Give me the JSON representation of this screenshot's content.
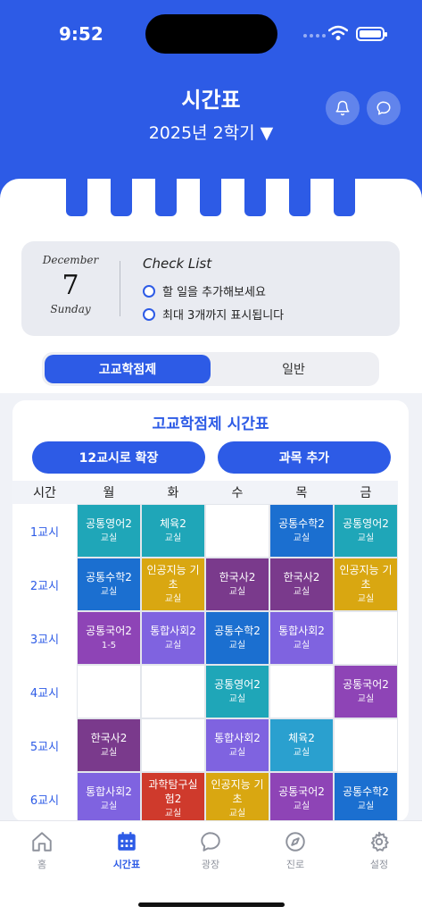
{
  "status_bar": {
    "time": "9:52"
  },
  "header": {
    "title": "시간표",
    "semester": "2025년 2학기 ▼",
    "bell_icon": "bell-icon",
    "chat_icon": "chat-bubble-icon"
  },
  "checklist": {
    "month": "December",
    "day": "7",
    "weekday": "Sunday",
    "title": "Check List",
    "items": [
      "할 일을 추가해보세요",
      "최대 3개까지 표시됩니다"
    ]
  },
  "mode_toggle": {
    "active": "고교학점제",
    "inactive": "일반"
  },
  "timetable": {
    "title": "고교학점제 시간표",
    "expand_button": "12교시로 확장",
    "add_subject_button": "과목 추가",
    "corner_header": "시간",
    "days": [
      "월",
      "화",
      "수",
      "목",
      "금"
    ],
    "periods": [
      "1교시",
      "2교시",
      "3교시",
      "4교시",
      "5교시",
      "6교시"
    ],
    "rows": [
      [
        {
          "name": "공통영어2",
          "room": "교실",
          "color": "#1fa6b8"
        },
        {
          "name": "체육2",
          "room": "교실",
          "color": "#1fa6b8"
        },
        null,
        {
          "name": "공통수학2",
          "room": "교실",
          "color": "#1b6fd0"
        },
        {
          "name": "공통영어2",
          "room": "교실",
          "color": "#1fa6b8"
        }
      ],
      [
        {
          "name": "공통수학2",
          "room": "교실",
          "color": "#1b6fd0"
        },
        {
          "name": "인공지능 기초",
          "room": "교실",
          "color": "#d9a711"
        },
        {
          "name": "한국사2",
          "room": "교실",
          "color": "#7a3a8c"
        },
        {
          "name": "한국사2",
          "room": "교실",
          "color": "#7a3a8c"
        },
        {
          "name": "인공지능 기초",
          "room": "교실",
          "color": "#d9a711"
        }
      ],
      [
        {
          "name": "공통국어2",
          "room": "1-5",
          "color": "#8e44b6"
        },
        {
          "name": "통합사회2",
          "room": "교실",
          "color": "#7f63e0"
        },
        {
          "name": "공통수학2",
          "room": "교실",
          "color": "#1b6fd0"
        },
        {
          "name": "통합사회2",
          "room": "교실",
          "color": "#7f63e0"
        },
        null
      ],
      [
        null,
        null,
        {
          "name": "공통영어2",
          "room": "교실",
          "color": "#1fa6b8"
        },
        null,
        {
          "name": "공통국어2",
          "room": "교실",
          "color": "#8e44b6"
        }
      ],
      [
        {
          "name": "한국사2",
          "room": "교실",
          "color": "#7a3a8c"
        },
        null,
        {
          "name": "통합사회2",
          "room": "교실",
          "color": "#7f63e0"
        },
        {
          "name": "체육2",
          "room": "교실",
          "color": "#2aa0cf"
        },
        null
      ],
      [
        {
          "name": "통합사회2",
          "room": "교실",
          "color": "#7f63e0"
        },
        {
          "name": "과학탐구실험2",
          "room": "교실",
          "color": "#cf3a2c"
        },
        {
          "name": "인공지능 기초",
          "room": "교실",
          "color": "#d9a711"
        },
        {
          "name": "공통국어2",
          "room": "교실",
          "color": "#8e44b6"
        },
        {
          "name": "공통수학2",
          "room": "교실",
          "color": "#1b6fd0"
        }
      ]
    ]
  },
  "bottom_nav": [
    {
      "label": "홈",
      "icon": "home-icon",
      "active": false
    },
    {
      "label": "시간표",
      "icon": "calendar-icon",
      "active": true
    },
    {
      "label": "광장",
      "icon": "chat-bubble-icon",
      "active": false
    },
    {
      "label": "진로",
      "icon": "compass-icon",
      "active": false
    },
    {
      "label": "설정",
      "icon": "gear-icon",
      "active": false
    }
  ],
  "colors": {
    "primary": "#2d5be6",
    "background": "#f0f2f7"
  }
}
